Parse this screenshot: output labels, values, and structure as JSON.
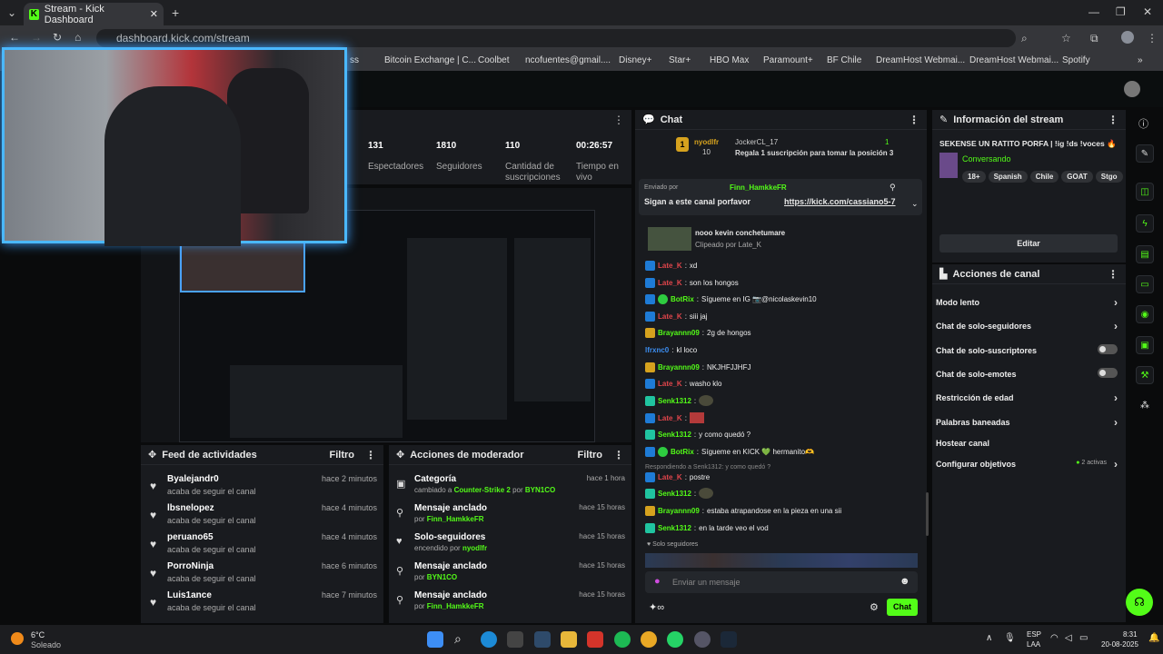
{
  "browser": {
    "tab_title": "Stream - Kick Dashboard",
    "url": "dashboard.kick.com/stream",
    "bookmarks": [
      "ss",
      "Bitcoin Exchange | C...",
      "Coolbet",
      "ncofuentes@gmail....",
      "Disney+",
      "Star+",
      "HBO Max",
      "Paramount+",
      "BF Chile",
      "DreamHost Webmai...",
      "DreamHost Webmai...",
      "Spotify"
    ]
  },
  "stats": [
    {
      "value": "131",
      "label": "Espectadores"
    },
    {
      "value": "1810",
      "label": "Seguidores"
    },
    {
      "value": "110",
      "label": "Cantidad de suscripciones"
    },
    {
      "value": "00:26:57",
      "label": "Tiempo en vivo"
    }
  ],
  "activity_feed": {
    "title": "Feed de actividades",
    "filter": "Filtro",
    "items": [
      {
        "name": "Byalejandr0",
        "action": "acaba de seguir el canal",
        "time": "hace 2 minutos"
      },
      {
        "name": "lbsnelopez",
        "action": "acaba de seguir el canal",
        "time": "hace 4 minutos"
      },
      {
        "name": "peruano65",
        "action": "acaba de seguir el canal",
        "time": "hace 4 minutos"
      },
      {
        "name": "PorroNinja",
        "action": "acaba de seguir el canal",
        "time": "hace 6 minutos"
      },
      {
        "name": "Luis1ance",
        "action": "acaba de seguir el canal",
        "time": "hace 7 minutos"
      }
    ]
  },
  "mod_actions": {
    "title": "Acciones de moderador",
    "filter": "Filtro",
    "items": [
      {
        "name": "Categoría",
        "pre": "cambiado a",
        "hl": "Counter-Strike 2",
        "mid": "por",
        "who": "BYN1CO",
        "time": "hace 1 hora"
      },
      {
        "name": "Mensaje anclado",
        "pre": "por",
        "hl": "Finn_HamkkeFR",
        "mid": "",
        "who": "",
        "time": "hace 15 horas"
      },
      {
        "name": "Solo-seguidores",
        "pre": "encendido por",
        "hl": "nyodlfr",
        "mid": "",
        "who": "",
        "time": "hace 15 horas"
      },
      {
        "name": "Mensaje anclado",
        "pre": "por",
        "hl": "BYN1CO",
        "mid": "",
        "who": "",
        "time": "hace 15 horas"
      },
      {
        "name": "Mensaje anclado",
        "pre": "por",
        "hl": "Finn_HamkkeFR",
        "mid": "",
        "who": "",
        "time": "hace 15 horas"
      }
    ]
  },
  "chat": {
    "title": "Chat",
    "top_gifter": {
      "rank": "1",
      "name": "nyodlfr",
      "count": "10",
      "user": "JockerCL_17",
      "subs": "1",
      "text": "Regala 1 suscripción para tomar la posición 3"
    },
    "pinned": {
      "by_label": "Enviado por",
      "by": "Finn_HamkkeFR",
      "text": "Sigan a este canal porfavor",
      "link": "https://kick.com/cassiano5-7"
    },
    "clip": {
      "title": "nooo kevin conchetumare",
      "by": "Clipeado por Late_K"
    },
    "messages": [
      {
        "user": "Late_K",
        "color": "#e0454b",
        "text": "xd",
        "badge": ""
      },
      {
        "user": "Late_K",
        "color": "#e0454b",
        "text": "son los hongos",
        "badge": ""
      },
      {
        "user": "BotRix",
        "color": "#53fc18",
        "text": "Sígueme en IG 📷@nicolaskevin10",
        "badge": "vip"
      },
      {
        "user": "Late_K",
        "color": "#e0454b",
        "text": "siii jaj",
        "badge": ""
      },
      {
        "user": "Brayannn09",
        "color": "#53fc18",
        "text": "2g de hongos",
        "badge": "crown"
      },
      {
        "user": "lfrxnc0",
        "color": "#3c8df0",
        "text": "kl loco",
        "badge": "none"
      },
      {
        "user": "Brayannn09",
        "color": "#53fc18",
        "text": "NKJHFJJHFJ",
        "badge": "crown"
      },
      {
        "user": "Late_K",
        "color": "#e0454b",
        "text": "washo klo",
        "badge": ""
      },
      {
        "user": "Senk1312",
        "color": "#53fc18",
        "text": "[emote]",
        "badge": "sub"
      },
      {
        "user": "Late_K",
        "color": "#e0454b",
        "text": "[emote]",
        "badge": ""
      },
      {
        "user": "Senk1312",
        "color": "#53fc18",
        "text": "y como quedó ?",
        "badge": "sub"
      },
      {
        "user": "BotRix",
        "color": "#53fc18",
        "text": "Sígueme en KICK 💚 hermanito🫶",
        "badge": "vip"
      }
    ],
    "reply_note": "Respondiendo a Senk1312: y como quedó ?",
    "messages2": [
      {
        "user": "Late_K",
        "color": "#e0454b",
        "text": "postre",
        "badge": ""
      },
      {
        "user": "Senk1312",
        "color": "#53fc18",
        "text": "[emote]",
        "badge": "sub"
      },
      {
        "user": "Brayannn09",
        "color": "#53fc18",
        "text": "estaba atrapandose en la pieza en una sii",
        "badge": "crown"
      },
      {
        "user": "Senk1312",
        "color": "#53fc18",
        "text": "en la tarde veo el vod",
        "badge": "sub"
      }
    ],
    "followers_only": "Solo seguidores",
    "placeholder": "Enviar un mensaje",
    "send": "Chat"
  },
  "stream_info": {
    "title": "Información del stream",
    "stream_title": "SEKENSE UN RATITO PORFA | !ig !ds !voces 🔥",
    "category": "Conversando",
    "tags": [
      "18+",
      "Spanish",
      "Chile",
      "GOAT",
      "Stgo"
    ],
    "edit": "Editar"
  },
  "channel_actions": {
    "title": "Acciones de canal",
    "items": [
      {
        "label": "Modo lento",
        "type": "arrow"
      },
      {
        "label": "Chat de solo-seguidores",
        "type": "arrow"
      },
      {
        "label": "Chat de solo-suscriptores",
        "type": "toggle"
      },
      {
        "label": "Chat de solo-emotes",
        "type": "toggle"
      },
      {
        "label": "Restricción de edad",
        "type": "arrow"
      },
      {
        "label": "Palabras baneadas",
        "type": "arrow"
      },
      {
        "label": "Hostear canal",
        "type": "none"
      },
      {
        "label": "Configurar objetivos",
        "type": "arrow",
        "extra": "2 activas"
      }
    ]
  },
  "weather": {
    "temp": "6°C",
    "desc": "Soleado"
  },
  "system_tray": {
    "lang": "ESP",
    "layout": "LAA",
    "time": "8:31",
    "date": "20-08-2025"
  },
  "colors": {
    "accent": "#53fc18",
    "panel": "#191b1f"
  }
}
